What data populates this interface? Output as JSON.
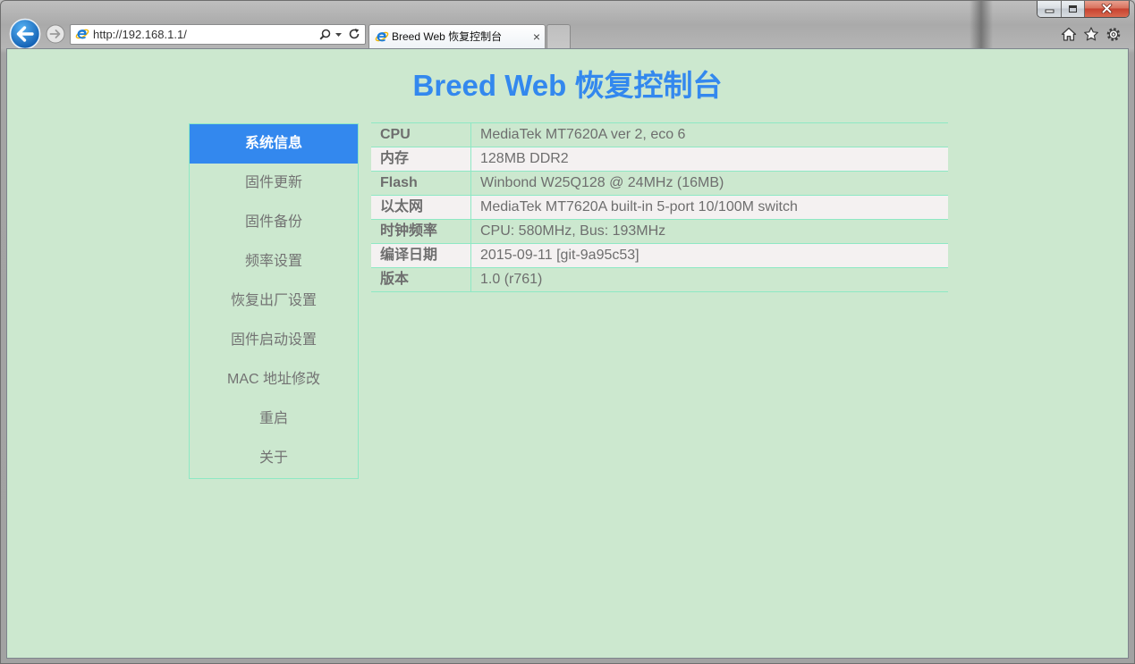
{
  "window": {
    "controls": {
      "minimize_icon": "minimize-icon",
      "maximize_icon": "maximize-icon",
      "close_icon": "close-icon"
    }
  },
  "browser": {
    "back_icon": "back-arrow-icon",
    "forward_icon": "forward-arrow-icon",
    "address_bar": {
      "site_icon": "ie-logo-icon",
      "url": "http://192.168.1.1/",
      "search_icon": "search-icon",
      "dropdown_icon": "dropdown-arrow-icon",
      "refresh_icon": "refresh-icon"
    },
    "tabs": [
      {
        "title": "Breed Web 恢复控制台",
        "icon": "ie-logo-icon",
        "close_label": "×",
        "active": true
      }
    ],
    "toolbar_icons": [
      "home-icon",
      "favorites-star-icon",
      "gear-icon"
    ]
  },
  "page": {
    "title": "Breed Web 恢复控制台",
    "nav": [
      {
        "label": "系统信息",
        "active": true
      },
      {
        "label": "固件更新",
        "active": false
      },
      {
        "label": "固件备份",
        "active": false
      },
      {
        "label": "频率设置",
        "active": false
      },
      {
        "label": "恢复出厂设置",
        "active": false
      },
      {
        "label": "固件启动设置",
        "active": false
      },
      {
        "label": "MAC 地址修改",
        "active": false
      },
      {
        "label": "重启",
        "active": false
      },
      {
        "label": "关于",
        "active": false
      }
    ],
    "system_info": [
      {
        "label": "CPU",
        "value": "MediaTek MT7620A ver 2, eco 6"
      },
      {
        "label": "内存",
        "value": "128MB DDR2"
      },
      {
        "label": "Flash",
        "value": "Winbond W25Q128 @ 24MHz (16MB)"
      },
      {
        "label": "以太网",
        "value": "MediaTek MT7620A built-in 5-port 10/100M switch"
      },
      {
        "label": "时钟频率",
        "value": "CPU: 580MHz, Bus: 193MHz"
      },
      {
        "label": "编译日期",
        "value": "2015-09-11 [git-9a95c53]"
      },
      {
        "label": "版本",
        "value": "1.0 (r761)"
      }
    ]
  },
  "colors": {
    "page_background": "#cce8cf",
    "accent": "#3388ee",
    "table_line": "#8ee8c4",
    "alt_row": "#f4f1f1",
    "text": "#6e6e6e",
    "window_close": "#c7412f"
  }
}
